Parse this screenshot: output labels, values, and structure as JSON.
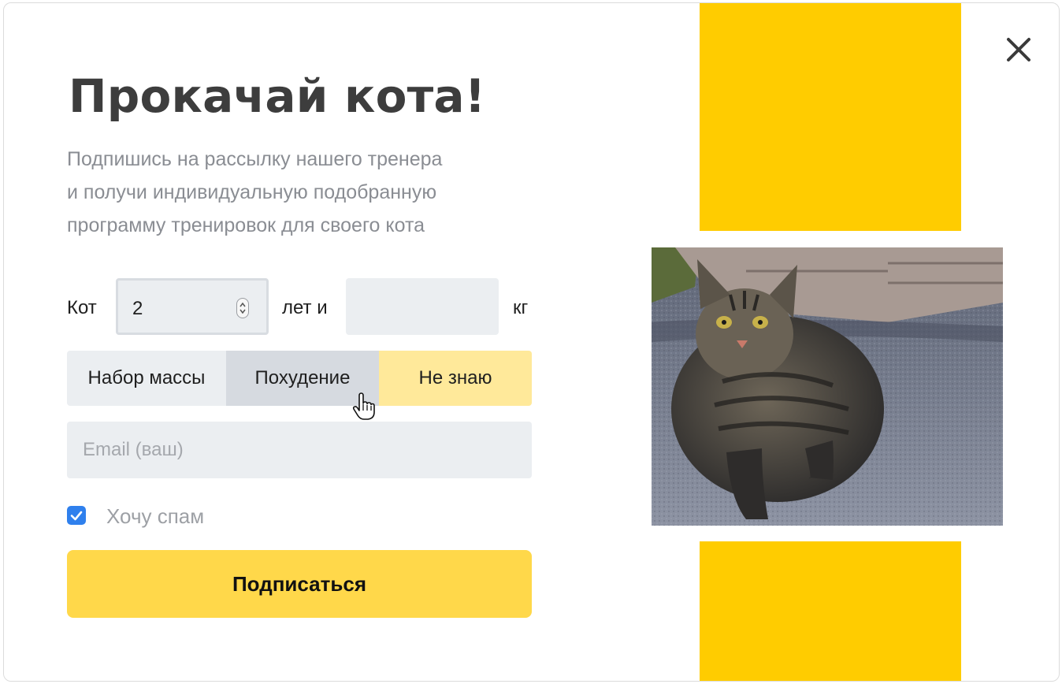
{
  "modal": {
    "title": "Прокачай кота!",
    "subtitle_lines": [
      "Подпишись на рассылку нашего тренера",
      "и получи индивидуальную подобранную",
      "программу тренировок для своего кота"
    ],
    "close_icon": "close-icon"
  },
  "form": {
    "cat_label": "Кот",
    "age_value": "2",
    "age_suffix": "лет и",
    "weight_value": "",
    "weight_suffix": "кг",
    "goals": [
      {
        "label": "Набор массы",
        "state": "default"
      },
      {
        "label": "Похудение",
        "state": "hover"
      },
      {
        "label": "Не знаю",
        "state": "selected"
      }
    ],
    "email_placeholder": "Email (ваш)",
    "spam_checked": true,
    "spam_label": "Хочу спам",
    "submit_label": "Подписаться"
  },
  "colors": {
    "accent_yellow": "#ffcc00",
    "button_yellow": "#ffd84a",
    "selected_goal": "#ffe99a",
    "input_bg": "#ebeef1",
    "checkbox_blue": "#2f80ed"
  }
}
